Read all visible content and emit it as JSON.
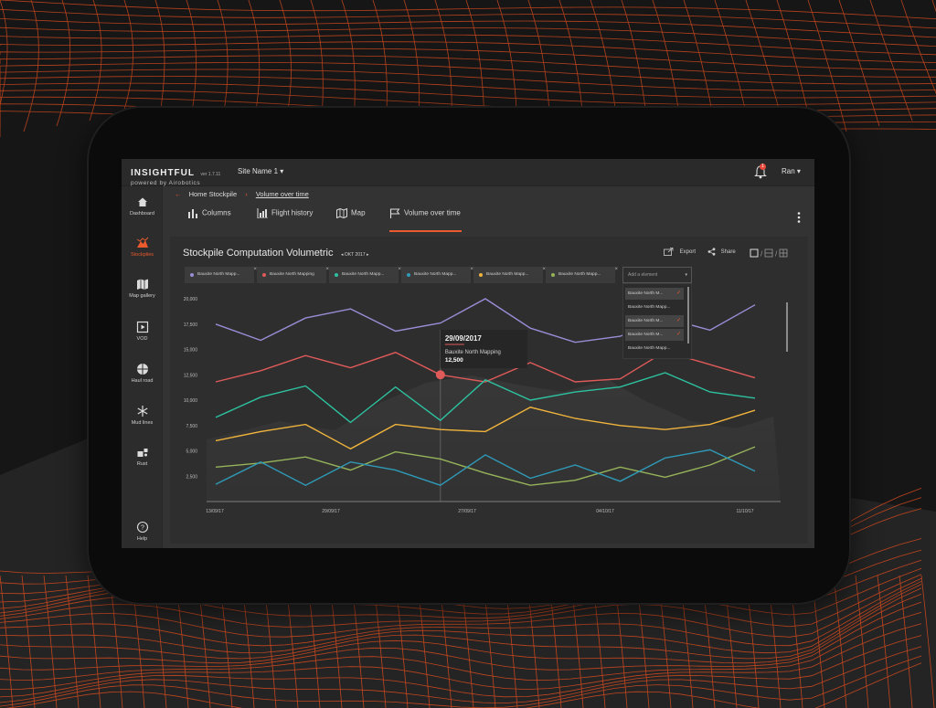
{
  "app": {
    "brand": "INSIGHTFUL",
    "version": "ver 1.7.11",
    "powered_by": "powered by Airobotics",
    "site": "Site Name 1",
    "user": "Ran",
    "notification_count": "1"
  },
  "sidebar": {
    "items": [
      {
        "label": "Dashboard",
        "icon": "home-icon"
      },
      {
        "label": "Stockpiles",
        "icon": "stockpile-icon",
        "active": true
      },
      {
        "label": "Map gallery",
        "icon": "map-icon"
      },
      {
        "label": "VOD",
        "icon": "video-icon"
      },
      {
        "label": "Haul road",
        "icon": "haul-road-icon"
      },
      {
        "label": "Mud lines",
        "icon": "snowflake-icon"
      },
      {
        "label": "Rust",
        "icon": "rust-icon"
      }
    ],
    "help": "Help"
  },
  "breadcrumb": {
    "home": "Home Stockpile",
    "current": "Volume over time"
  },
  "tabs": [
    {
      "label": "Columns",
      "icon": "bar-chart-icon"
    },
    {
      "label": "Flight history",
      "icon": "flight-history-icon"
    },
    {
      "label": "Map",
      "icon": "map-icon"
    },
    {
      "label": "Volume over time",
      "icon": "flag-icon",
      "active": true
    }
  ],
  "card": {
    "title": "Stockpile Computation Volumetric",
    "month": "OKT 2017",
    "export": "Export",
    "share": "Share"
  },
  "chips": [
    {
      "label": "Bauxite North Mapp...",
      "color": "#9b8cd6"
    },
    {
      "label": "Bauxite North Mapping",
      "color": "#e05a5a"
    },
    {
      "label": "Bauxite North Mapp...",
      "color": "#2dc2a0"
    },
    {
      "label": "Bauxite North Mapp...",
      "color": "#2f9ab8"
    },
    {
      "label": "Bauxite North Mapp...",
      "color": "#f0b43c"
    },
    {
      "label": "Bauxite North Mapp...",
      "color": "#96b45a"
    }
  ],
  "dropdown": {
    "placeholder": "Add a element",
    "items": [
      {
        "label": "Bauxite North M...",
        "checked": true
      },
      {
        "label": "Bauxite North Mapp...",
        "checked": false
      },
      {
        "label": "Bauxite North M...",
        "checked": true
      },
      {
        "label": "Bauxite North M...",
        "checked": true
      },
      {
        "label": "Bauxite North Mapp...",
        "checked": false
      }
    ]
  },
  "tooltip": {
    "date": "29/09/2017",
    "series": "Bauxite North Mapping",
    "value": "12,500"
  },
  "chart_data": {
    "type": "line",
    "title": "Stockpile Computation Volumetric",
    "ylim": [
      0,
      20000
    ],
    "yticks": [
      "2,500",
      "5,000",
      "7,500",
      "10,000",
      "12,500",
      "15,000",
      "17,500",
      "20,000"
    ],
    "x_tick_labels": [
      "13/09/17",
      "29/09/17",
      "27/09/17",
      "04/10/17",
      "11/10/17"
    ],
    "grid": false,
    "x": [
      0,
      1,
      2,
      3,
      4,
      5,
      6,
      7,
      8,
      9,
      10,
      11,
      12
    ],
    "series": [
      {
        "color": "#9b8cd6",
        "values": [
          17500,
          15900,
          18100,
          19000,
          16800,
          17600,
          20000,
          17100,
          15700,
          16300,
          18100,
          16900,
          19400
        ]
      },
      {
        "color": "#e05a5a",
        "values": [
          11800,
          12900,
          14400,
          13200,
          14700,
          12500,
          11800,
          13700,
          11800,
          12100,
          14800,
          13500,
          12200
        ]
      },
      {
        "color": "#2dc2a0",
        "values": [
          8300,
          10300,
          11400,
          7800,
          11300,
          8000,
          12000,
          10000,
          10800,
          11300,
          12700,
          10800,
          10200
        ]
      },
      {
        "color": "#f0b43c",
        "values": [
          6000,
          6900,
          7600,
          5200,
          7600,
          7100,
          6900,
          9300,
          8200,
          7500,
          7100,
          7600,
          9000
        ]
      },
      {
        "color": "#96b45a",
        "values": [
          3400,
          3800,
          4400,
          3100,
          4900,
          4200,
          2800,
          1600,
          2100,
          3400,
          2400,
          3600,
          5400
        ]
      },
      {
        "color": "#2f9ab8",
        "values": [
          1700,
          3900,
          1600,
          3900,
          3100,
          1600,
          4600,
          2300,
          3600,
          2000,
          4300,
          5100,
          3000
        ]
      }
    ],
    "highlight": {
      "series_index": 1,
      "point_index": 5
    }
  }
}
